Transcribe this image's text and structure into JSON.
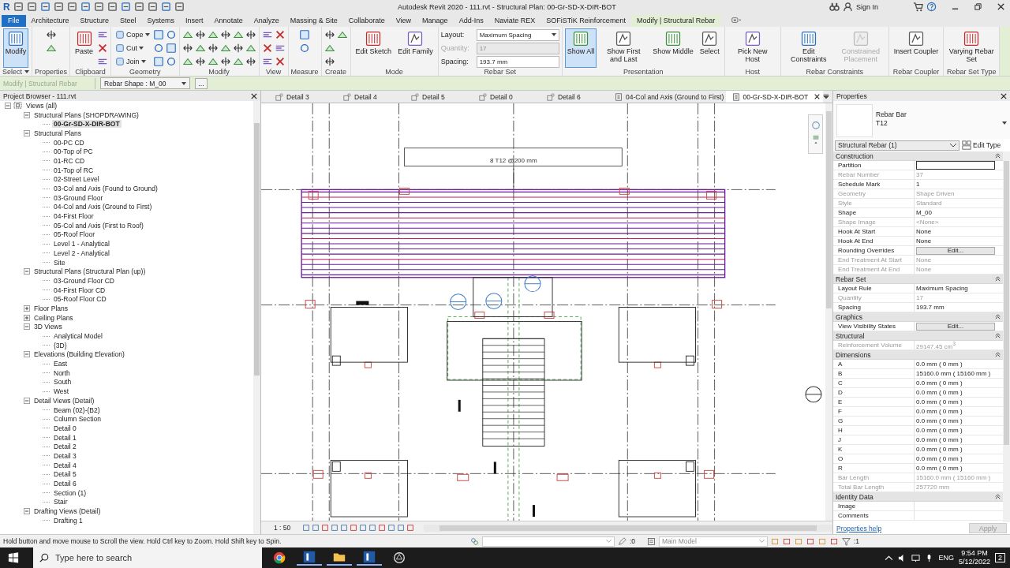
{
  "app_logo": "R",
  "title": "Autodesk Revit 2020 - 111.rvt - Structural Plan: 00-Gr-SD-X-DIR-BOT",
  "sign_in": "Sign In",
  "menu_tabs": [
    {
      "label": "File",
      "kind": "file",
      "selected": false
    },
    {
      "label": "Architecture",
      "kind": "tab",
      "selected": false
    },
    {
      "label": "Structure",
      "kind": "tab",
      "selected": false
    },
    {
      "label": "Steel",
      "kind": "tab",
      "selected": false
    },
    {
      "label": "Systems",
      "kind": "tab",
      "selected": false
    },
    {
      "label": "Insert",
      "kind": "tab",
      "selected": false
    },
    {
      "label": "Annotate",
      "kind": "tab",
      "selected": false
    },
    {
      "label": "Analyze",
      "kind": "tab",
      "selected": false
    },
    {
      "label": "Massing & Site",
      "kind": "tab",
      "selected": false
    },
    {
      "label": "Collaborate",
      "kind": "tab",
      "selected": false
    },
    {
      "label": "View",
      "kind": "tab",
      "selected": false
    },
    {
      "label": "Manage",
      "kind": "tab",
      "selected": false
    },
    {
      "label": "Add-Ins",
      "kind": "tab",
      "selected": false
    },
    {
      "label": "Naviate REX",
      "kind": "tab",
      "selected": false
    },
    {
      "label": "SOFiSTiK Reinforcement",
      "kind": "tab",
      "selected": false
    },
    {
      "label": "Modify | Structural Rebar",
      "kind": "tab",
      "selected": true
    }
  ],
  "ribbon_panels": [
    {
      "title": "Select",
      "menu": true,
      "tools": [
        {
          "kind": "large",
          "label": "Modify",
          "selected": true,
          "disabled": false
        }
      ]
    },
    {
      "title": "Properties",
      "tools": [
        {
          "kind": "icon"
        },
        {
          "kind": "icon"
        }
      ]
    },
    {
      "title": "Clipboard",
      "tools": [
        {
          "kind": "large",
          "label": "Paste",
          "selected": false,
          "disabled": false
        },
        {
          "kind": "icon"
        },
        {
          "kind": "icon"
        },
        {
          "kind": "icon"
        }
      ]
    },
    {
      "title": "Geometry",
      "tools": [
        {
          "kind": "small",
          "label": "Cope"
        },
        {
          "kind": "small",
          "label": "Cut"
        },
        {
          "kind": "small",
          "label": "Join"
        },
        {
          "kind": "icon"
        },
        {
          "kind": "icon"
        },
        {
          "kind": "icon"
        },
        {
          "kind": "icon"
        },
        {
          "kind": "icon"
        },
        {
          "kind": "icon"
        }
      ]
    },
    {
      "title": "Modify",
      "tools": [
        {
          "kind": "icon"
        },
        {
          "kind": "icon"
        },
        {
          "kind": "icon"
        },
        {
          "kind": "icon"
        },
        {
          "kind": "icon"
        },
        {
          "kind": "icon"
        },
        {
          "kind": "icon"
        },
        {
          "kind": "icon"
        },
        {
          "kind": "icon"
        },
        {
          "kind": "icon"
        },
        {
          "kind": "icon"
        },
        {
          "kind": "icon"
        },
        {
          "kind": "icon"
        },
        {
          "kind": "icon"
        },
        {
          "kind": "icon"
        },
        {
          "kind": "icon"
        },
        {
          "kind": "icon"
        },
        {
          "kind": "icon"
        }
      ]
    },
    {
      "title": "View",
      "tools": [
        {
          "kind": "icon"
        },
        {
          "kind": "icon"
        },
        {
          "kind": "icon"
        },
        {
          "kind": "icon"
        },
        {
          "kind": "icon"
        },
        {
          "kind": "icon"
        }
      ]
    },
    {
      "title": "Measure",
      "tools": [
        {
          "kind": "icon"
        },
        {
          "kind": "icon"
        }
      ]
    },
    {
      "title": "Create",
      "tools": [
        {
          "kind": "icon"
        },
        {
          "kind": "icon"
        },
        {
          "kind": "icon"
        },
        {
          "kind": "icon"
        }
      ]
    },
    {
      "title": "Mode",
      "tools": [
        {
          "kind": "large",
          "label": "Edit Sketch",
          "selected": false,
          "disabled": false
        },
        {
          "kind": "large",
          "label": "Edit Family",
          "selected": false,
          "disabled": false
        }
      ]
    },
    {
      "title": "Rebar Set",
      "tools": [
        {
          "kind": "field",
          "label": "Layout:",
          "value": "Maximum Spacing",
          "dropdown": true,
          "disabled": false
        },
        {
          "kind": "field",
          "label": "Quantity:",
          "value": "17",
          "dropdown": false,
          "disabled": true
        },
        {
          "kind": "field",
          "label": "Spacing:",
          "value": "193.7 mm",
          "dropdown": false,
          "disabled": false
        }
      ]
    },
    {
      "title": "Presentation",
      "tools": [
        {
          "kind": "large",
          "label": "Show All",
          "selected": true,
          "disabled": false
        },
        {
          "kind": "large",
          "label": "Show First and Last",
          "selected": false,
          "disabled": false
        },
        {
          "kind": "large",
          "label": "Show Middle",
          "selected": false,
          "disabled": false
        },
        {
          "kind": "large",
          "label": "Select",
          "selected": false,
          "disabled": false
        }
      ]
    },
    {
      "title": "Host",
      "tools": [
        {
          "kind": "large",
          "label": "Pick New Host",
          "selected": false,
          "disabled": false
        }
      ]
    },
    {
      "title": "Rebar Constraints",
      "tools": [
        {
          "kind": "large",
          "label": "Edit Constraints",
          "selected": false,
          "disabled": false
        },
        {
          "kind": "large",
          "label": "Constrained Placement",
          "selected": false,
          "disabled": true
        }
      ]
    },
    {
      "title": "Rebar Coupler",
      "tools": [
        {
          "kind": "large",
          "label": "Insert Coupler",
          "selected": false,
          "disabled": false
        }
      ]
    },
    {
      "title": "Rebar Set Type",
      "tools": [
        {
          "kind": "large",
          "label": "Varying Rebar Set",
          "selected": false,
          "disabled": false
        }
      ]
    }
  ],
  "options_bar": {
    "context": "Modify | Structural Rebar",
    "shape": "Rebar Shape : M_00",
    "more": "..."
  },
  "browser": {
    "title": "Project Browser - 111.rvt",
    "tree": [
      {
        "label": "Views (all)",
        "selected": false,
        "expanded": true,
        "children": [
          {
            "label": "Structural Plans (SHOPDRAWING)",
            "selected": false,
            "expanded": true,
            "children": [
              {
                "label": "00-Gr-SD-X-DIR-BOT",
                "selected": true
              }
            ]
          },
          {
            "label": "Structural Plans",
            "selected": false,
            "expanded": true,
            "children": [
              {
                "label": "00-PC CD",
                "selected": false
              },
              {
                "label": "00-Top of PC",
                "selected": false
              },
              {
                "label": "01-RC CD",
                "selected": false
              },
              {
                "label": "01-Top of RC",
                "selected": false
              },
              {
                "label": "02-Street Level",
                "selected": false
              },
              {
                "label": "03-Col and Axis (Found to Ground)",
                "selected": false
              },
              {
                "label": "03-Ground Floor",
                "selected": false
              },
              {
                "label": "04-Col and Axis (Ground to First)",
                "selected": false
              },
              {
                "label": "04-First Floor",
                "selected": false
              },
              {
                "label": "05-Col and Axis (First to Roof)",
                "selected": false
              },
              {
                "label": "05-Roof Floor",
                "selected": false
              },
              {
                "label": "Level 1 - Analytical",
                "selected": false
              },
              {
                "label": "Level 2 - Analytical",
                "selected": false
              },
              {
                "label": "Site",
                "selected": false
              }
            ]
          },
          {
            "label": "Structural Plans (Structural Plan (up))",
            "selected": false,
            "expanded": true,
            "children": [
              {
                "label": "03-Ground Floor CD",
                "selected": false
              },
              {
                "label": "04-First Floor CD",
                "selected": false
              },
              {
                "label": "05-Roof Floor CD",
                "selected": false
              }
            ]
          },
          {
            "label": "Floor Plans",
            "selected": false,
            "expanded": false
          },
          {
            "label": "Ceiling Plans",
            "selected": false,
            "expanded": false
          },
          {
            "label": "3D Views",
            "selected": false,
            "expanded": true,
            "children": [
              {
                "label": "Analytical Model",
                "selected": false
              },
              {
                "label": "{3D}",
                "selected": false
              }
            ]
          },
          {
            "label": "Elevations (Building Elevation)",
            "selected": false,
            "expanded": true,
            "children": [
              {
                "label": "East",
                "selected": false
              },
              {
                "label": "North",
                "selected": false
              },
              {
                "label": "South",
                "selected": false
              },
              {
                "label": "West",
                "selected": false
              }
            ]
          },
          {
            "label": "Detail Views (Detail)",
            "selected": false,
            "expanded": true,
            "children": [
              {
                "label": "Beam (02)-(B2)",
                "selected": false
              },
              {
                "label": "Column Section",
                "selected": false
              },
              {
                "label": "Detail 0",
                "selected": false
              },
              {
                "label": "Detail 1",
                "selected": false
              },
              {
                "label": "Detail 2",
                "selected": false
              },
              {
                "label": "Detail 3",
                "selected": false
              },
              {
                "label": "Detail 4",
                "selected": false
              },
              {
                "label": "Detail 5",
                "selected": false
              },
              {
                "label": "Detail 6",
                "selected": false
              },
              {
                "label": "Section (1)",
                "selected": false
              },
              {
                "label": "Stair",
                "selected": false
              }
            ]
          },
          {
            "label": "Drafting Views (Detail)",
            "selected": false,
            "expanded": true,
            "children": [
              {
                "label": "Drafting 1",
                "selected": false
              }
            ]
          }
        ]
      }
    ]
  },
  "view_tabs": [
    {
      "label": "Detail 3",
      "kind": "detail",
      "selected": false
    },
    {
      "label": "Detail 4",
      "kind": "detail",
      "selected": false
    },
    {
      "label": "Detail 5",
      "kind": "detail",
      "selected": false
    },
    {
      "label": "Detail 0",
      "kind": "detail",
      "selected": false
    },
    {
      "label": "Detail 6",
      "kind": "detail",
      "selected": false
    },
    {
      "label": "04-Col and Axis (Ground to First)",
      "kind": "plan",
      "selected": false
    },
    {
      "label": "00-Gr-SD-X-DIR-BOT",
      "kind": "plan",
      "selected": true
    }
  ],
  "drawing": {
    "rebar_tag": "8 T12 @200 mm",
    "scale": "1 : 50"
  },
  "properties": {
    "title": "Properties",
    "type_family": "Rebar Bar",
    "type_name": "T12",
    "selector": "Structural Rebar (1)",
    "edit_type": "Edit Type",
    "groups": [
      {
        "name": "Construction",
        "rows": [
          {
            "label": "Partition",
            "kind": "input",
            "disabled": false
          },
          {
            "label": "Rebar Number",
            "value": "37",
            "kind": "text",
            "disabled": true
          },
          {
            "label": "Schedule Mark",
            "value": "1",
            "kind": "text",
            "disabled": false
          },
          {
            "label": "Geometry",
            "value": "Shape Driven",
            "kind": "text",
            "disabled": true
          },
          {
            "label": "Style",
            "value": "Standard",
            "kind": "text",
            "disabled": true
          },
          {
            "label": "Shape",
            "value": "M_00",
            "kind": "text",
            "disabled": false
          },
          {
            "label": "Shape Image",
            "value": "<None>",
            "kind": "text",
            "disabled": true
          },
          {
            "label": "Hook At Start",
            "value": "None",
            "kind": "text",
            "disabled": false
          },
          {
            "label": "Hook At End",
            "value": "None",
            "kind": "text",
            "disabled": false
          },
          {
            "label": "Rounding Overrides",
            "value": "Edit...",
            "kind": "button",
            "disabled": false
          },
          {
            "label": "End Treatment At Start",
            "value": "None",
            "kind": "text",
            "disabled": true
          },
          {
            "label": "End Treatment At End",
            "value": "None",
            "kind": "text",
            "disabled": true
          }
        ]
      },
      {
        "name": "Rebar Set",
        "rows": [
          {
            "label": "Layout Rule",
            "value": "Maximum Spacing",
            "kind": "text",
            "disabled": false
          },
          {
            "label": "Quantity",
            "value": "17",
            "kind": "text",
            "disabled": true
          },
          {
            "label": "Spacing",
            "value": "193.7 mm",
            "kind": "text",
            "disabled": false
          }
        ]
      },
      {
        "name": "Graphics",
        "rows": [
          {
            "label": "View Visibility States",
            "value": "Edit...",
            "kind": "button",
            "disabled": false
          }
        ]
      },
      {
        "name": "Structural",
        "rows": [
          {
            "label": "Reinforcement Volume",
            "value": "29147.45 cm$^{3}$",
            "kind": "text",
            "disabled": true
          }
        ]
      },
      {
        "name": "Dimensions",
        "rows": [
          {
            "label": "A",
            "value": "0.0 mm ( 0 mm )",
            "kind": "text",
            "disabled": false
          },
          {
            "label": "B",
            "value": "15160.0 mm ( 15160 mm )",
            "kind": "text",
            "disabled": false
          },
          {
            "label": "C",
            "value": "0.0 mm ( 0 mm )",
            "kind": "text",
            "disabled": false
          },
          {
            "label": "D",
            "value": "0.0 mm ( 0 mm )",
            "kind": "text",
            "disabled": false
          },
          {
            "label": "E",
            "value": "0.0 mm ( 0 mm )",
            "kind": "text",
            "disabled": false
          },
          {
            "label": "F",
            "value": "0.0 mm ( 0 mm )",
            "kind": "text",
            "disabled": false
          },
          {
            "label": "G",
            "value": "0.0 mm ( 0 mm )",
            "kind": "text",
            "disabled": false
          },
          {
            "label": "H",
            "value": "0.0 mm ( 0 mm )",
            "kind": "text",
            "disabled": false
          },
          {
            "label": "J",
            "value": "0.0 mm ( 0 mm )",
            "kind": "text",
            "disabled": false
          },
          {
            "label": "K",
            "value": "0.0 mm ( 0 mm )",
            "kind": "text",
            "disabled": false
          },
          {
            "label": "O",
            "value": "0.0 mm ( 0 mm )",
            "kind": "text",
            "disabled": false
          },
          {
            "label": "R",
            "value": "0.0 mm ( 0 mm )",
            "kind": "text",
            "disabled": false
          },
          {
            "label": "Bar Length",
            "value": "15160.0 mm ( 15160 mm )",
            "kind": "text",
            "disabled": true
          },
          {
            "label": "Total Bar Length",
            "value": "257720 mm",
            "kind": "text",
            "disabled": true
          }
        ]
      },
      {
        "name": "Identity Data",
        "rows": [
          {
            "label": "Image",
            "kind": "text",
            "disabled": false
          },
          {
            "label": "Comments",
            "kind": "text",
            "disabled": false
          }
        ]
      }
    ],
    "help": "Properties help",
    "apply": "Apply"
  },
  "status_bar": {
    "message": "Hold button and move mouse to Scroll the view. Hold Ctrl key to Zoom. Hold Shift key to Spin.",
    "editable_count": ":0",
    "model": "Main Model",
    "filter_count": ":1"
  },
  "taskbar": {
    "search_placeholder": "Type here to search",
    "language": "ENG",
    "time": "9:54 PM",
    "date": "5/12/2022",
    "notifications": "2"
  }
}
